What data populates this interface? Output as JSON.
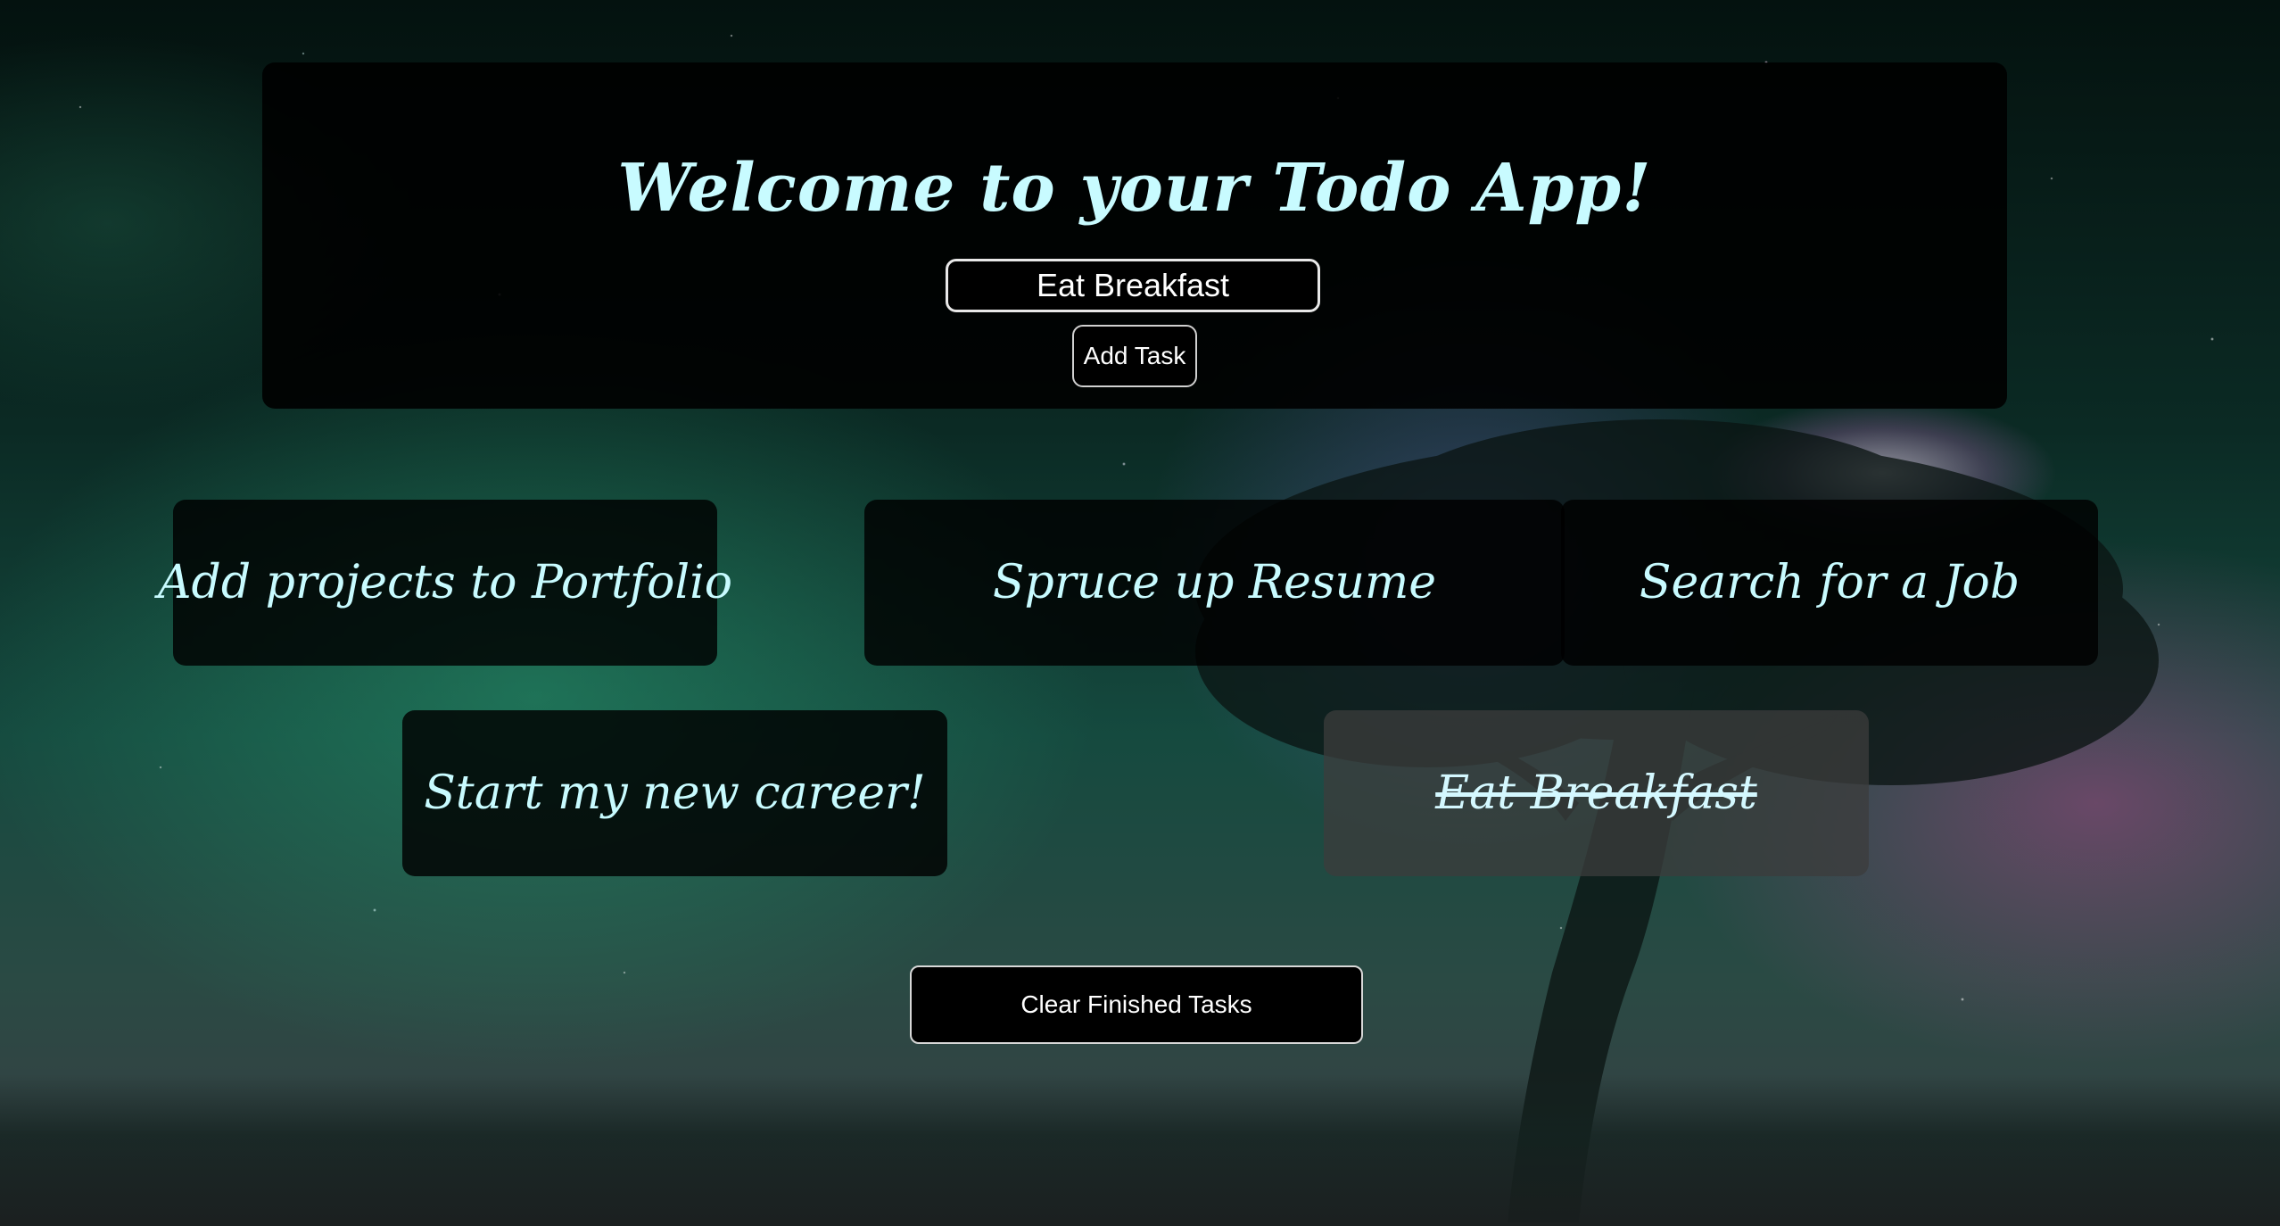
{
  "header": {
    "title": "Welcome to your Todo App!",
    "input_value": "Eat Breakfast",
    "add_button_label": "Add Task"
  },
  "tasks": [
    {
      "label": "Add projects to Portfolio",
      "done": false
    },
    {
      "label": "Spruce up Resume",
      "done": false
    },
    {
      "label": "Search for a Job",
      "done": false
    },
    {
      "label": "Start my new career!",
      "done": false
    },
    {
      "label": "Eat Breakfast",
      "done": true
    }
  ],
  "footer": {
    "clear_button_label": "Clear Finished Tasks"
  },
  "colors": {
    "title_text": "#c8fbff",
    "panel_background": "#000000",
    "done_card_background": "#3c3c3c"
  }
}
